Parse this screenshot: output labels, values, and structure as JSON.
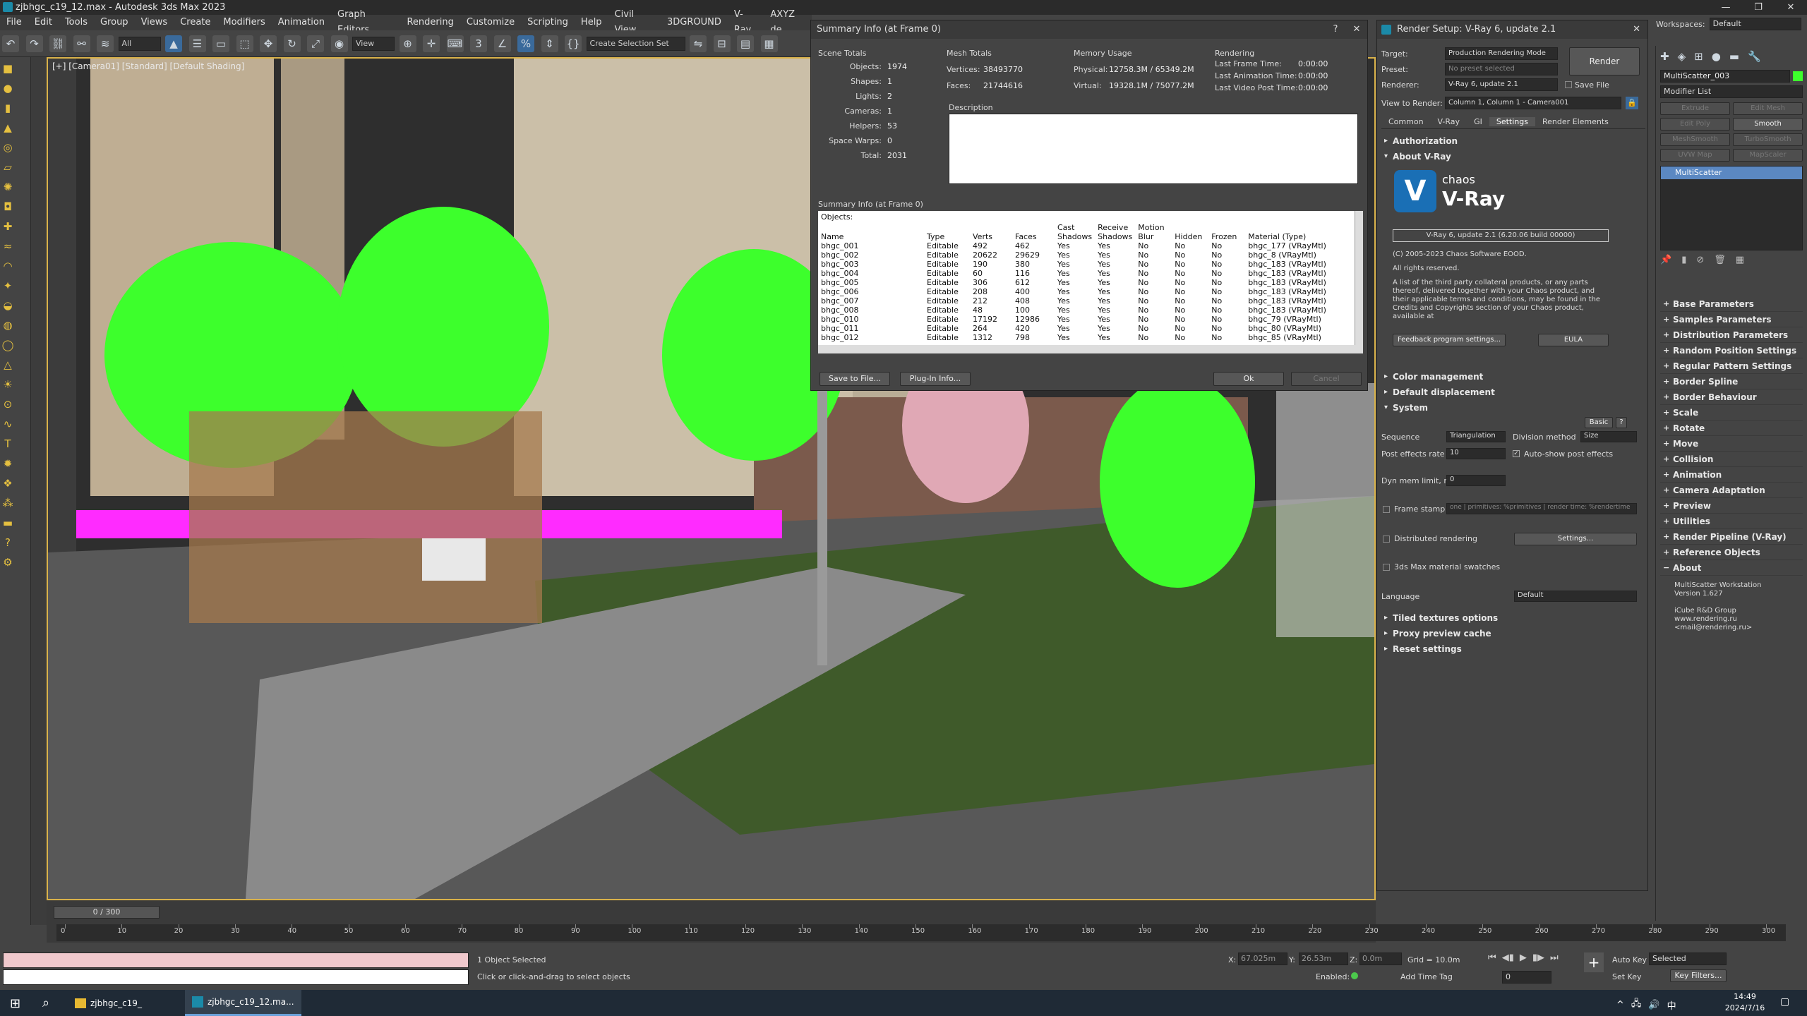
{
  "app": {
    "title": "zjbhgc_c19_12.max - Autodesk 3ds Max 2023",
    "workspaces_label": "Workspaces:",
    "workspaces_value": "Default"
  },
  "menu": [
    "File",
    "Edit",
    "Tools",
    "Group",
    "Views",
    "Create",
    "Modifiers",
    "Animation",
    "Graph Editors",
    "Rendering",
    "Customize",
    "Scripting",
    "Help",
    "Civil View",
    "3DGROUND",
    "V-Ray",
    "AXYZ de"
  ],
  "toolbar": {
    "filter_all": "All",
    "ref_coord": "View",
    "selection_set": "Create Selection Set"
  },
  "viewport": {
    "label": "[+] [Camera01] [Standard] [Default Shading]"
  },
  "summary": {
    "title": "Summary Info (at Frame 0)",
    "scene_totals_label": "Scene Totals",
    "scene_totals": [
      {
        "k": "Objects:",
        "v": "1974"
      },
      {
        "k": "Shapes:",
        "v": "1"
      },
      {
        "k": "Lights:",
        "v": "2"
      },
      {
        "k": "Cameras:",
        "v": "1"
      },
      {
        "k": "Helpers:",
        "v": "53"
      },
      {
        "k": "Space Warps:",
        "v": "0"
      },
      {
        "k": "Total:",
        "v": "2031"
      }
    ],
    "mesh_totals_label": "Mesh Totals",
    "vertices_label": "Vertices:",
    "vertices": "38493770",
    "faces_label": "Faces:",
    "faces": "21744616",
    "memory_label": "Memory Usage",
    "physical_label": "Physical:",
    "physical": "12758.3M / 65349.2M",
    "virtual_label": "Virtual:",
    "virtual": "19328.1M / 75077.2M",
    "rendering_label": "Rendering",
    "last_frame_label": "Last Frame Time:",
    "last_frame": "0:00:00",
    "last_anim_label": "Last Animation Time:",
    "last_anim": "0:00:00",
    "last_video_label": "Last Video Post Time:",
    "last_video": "0:00:00",
    "description_label": "Description",
    "list_title": "Summary Info (at Frame 0)",
    "objects_label": "Objects:",
    "columns": [
      "Name",
      "Type",
      "Verts",
      "Faces",
      "Cast Shadows",
      "Receive Shadows",
      "Motion Blur",
      "Hidden",
      "Frozen",
      "Material (Type)"
    ],
    "rows": [
      [
        "bhgc_001",
        "Editable",
        "492",
        "462",
        "Yes",
        "Yes",
        "No",
        "No",
        "No",
        "bhgc_177 (VRayMtl)"
      ],
      [
        "bhgc_002",
        "Editable",
        "20622",
        "29629",
        "Yes",
        "Yes",
        "No",
        "No",
        "No",
        "bhgc_8 (VRayMtl)"
      ],
      [
        "bhgc_003",
        "Editable",
        "190",
        "380",
        "Yes",
        "Yes",
        "No",
        "No",
        "No",
        "bhgc_183 (VRayMtl)"
      ],
      [
        "bhgc_004",
        "Editable",
        "60",
        "116",
        "Yes",
        "Yes",
        "No",
        "No",
        "No",
        "bhgc_183 (VRayMtl)"
      ],
      [
        "bhgc_005",
        "Editable",
        "306",
        "612",
        "Yes",
        "Yes",
        "No",
        "No",
        "No",
        "bhgc_183 (VRayMtl)"
      ],
      [
        "bhgc_006",
        "Editable",
        "208",
        "400",
        "Yes",
        "Yes",
        "No",
        "No",
        "No",
        "bhgc_183 (VRayMtl)"
      ],
      [
        "bhgc_007",
        "Editable",
        "212",
        "408",
        "Yes",
        "Yes",
        "No",
        "No",
        "No",
        "bhgc_183 (VRayMtl)"
      ],
      [
        "bhgc_008",
        "Editable",
        "48",
        "100",
        "Yes",
        "Yes",
        "No",
        "No",
        "No",
        "bhgc_183 (VRayMtl)"
      ],
      [
        "bhgc_010",
        "Editable",
        "17192",
        "12986",
        "Yes",
        "Yes",
        "No",
        "No",
        "No",
        "bhgc_79 (VRayMtl)"
      ],
      [
        "bhgc_011",
        "Editable",
        "264",
        "420",
        "Yes",
        "Yes",
        "No",
        "No",
        "No",
        "bhgc_80 (VRayMtl)"
      ],
      [
        "bhgc_012",
        "Editable",
        "1312",
        "798",
        "Yes",
        "Yes",
        "No",
        "No",
        "No",
        "bhgc_85 (VRayMtl)"
      ]
    ],
    "save_btn": "Save to File...",
    "plugin_btn": "Plug-In Info...",
    "ok_btn": "Ok",
    "cancel_btn": "Cancel"
  },
  "render": {
    "title": "Render Setup: V-Ray 6, update 2.1",
    "target_label": "Target:",
    "target_value": "Production Rendering Mode",
    "preset_label": "Preset:",
    "preset_value": "No preset selected",
    "renderer_label": "Renderer:",
    "renderer_value": "V-Ray 6, update 2.1",
    "save_file_label": "Save File",
    "render_btn": "Render",
    "view_label": "View to Render:",
    "view_value": "Column 1, Column 1 - Camera001",
    "tabs": [
      "Common",
      "V-Ray",
      "GI",
      "Settings",
      "Render Elements"
    ],
    "authorization": "Authorization",
    "about_vray": "About V-Ray",
    "chaos": "chaos",
    "vray": "V-Ray",
    "version": "V-Ray 6, update 2.1 (6.20.06 build 00000)",
    "copyright": "(C) 2005-2023 Chaos Software EOOD.",
    "rights": "All rights reserved.",
    "third_party": "A list of the third party collateral products, or any parts thereof, delivered together with your Chaos product, and their applicable terms and conditions, may be found in the Credits and Copyrights section of your Chaos product, available at",
    "feedback_btn": "Feedback program settings...",
    "eula_btn": "EULA",
    "color_mgmt": "Color management",
    "default_disp": "Default displacement",
    "system": "System",
    "basic_btn": "Basic",
    "help_btn": "?",
    "sequence_label": "Sequence",
    "sequence_value": "Triangulation",
    "division_label": "Division method",
    "division_value": "Size",
    "post_rate_label": "Post effects rate",
    "post_rate_value": "10",
    "auto_show_label": "Auto-show post effects",
    "dyn_mem_label": "Dyn mem limit, mb",
    "dyn_mem_value": "0",
    "frame_stamp_label": "Frame stamp",
    "frame_stamp_value": "one | primitives: %primitives | render time: %rendertime",
    "distributed_label": "Distributed rendering",
    "settings_btn": "Settings...",
    "swatches_label": "3ds Max material swatches",
    "language_label": "Language",
    "language_value": "Default",
    "tiled": "Tiled textures options",
    "proxy": "Proxy preview cache",
    "reset": "Reset settings"
  },
  "cmd": {
    "object_name": "MultiScatter_003",
    "modifier_list": "Modifier List",
    "mod_buttons": [
      "Extrude",
      "Edit Mesh",
      "Edit Poly",
      "Smooth",
      "MeshSmooth",
      "TurboSmooth",
      "UVW Map",
      "MapScaler"
    ],
    "stack_item": "MultiScatter",
    "rollouts": [
      "Base Parameters",
      "Samples Parameters",
      "Distribution Parameters",
      "Random Position Settings",
      "Regular Pattern Settings",
      "Border Spline",
      "Border Behaviour",
      "Scale",
      "Rotate",
      "Move",
      "Collision",
      "Animation",
      "Camera Adaptation",
      "Preview",
      "Utilities",
      "Render Pipeline (V-Ray)",
      "Reference Objects",
      "About"
    ],
    "about_lines": [
      "MultiScatter Workstation",
      "Version 1.627",
      "",
      "iCube R&D Group",
      "www.rendering.ru",
      "<mail@rendering.ru>"
    ]
  },
  "timeline": {
    "frame_counter": "0 / 300",
    "ticks": [
      "0",
      "10",
      "20",
      "30",
      "40",
      "50",
      "60",
      "70",
      "80",
      "90",
      "100",
      "110",
      "120",
      "130",
      "140",
      "150",
      "160",
      "170",
      "180",
      "190",
      "200",
      "210",
      "220",
      "230",
      "240",
      "250",
      "260",
      "270",
      "280",
      "290",
      "300"
    ]
  },
  "status": {
    "selection": "1 Object Selected",
    "prompt": "Click or click-and-drag to select objects",
    "x_label": "X:",
    "x_value": "67.025m",
    "y_label": "Y:",
    "y_value": "26.53m",
    "z_label": "Z:",
    "z_value": "0.0m",
    "grid": "Grid = 10.0m",
    "enabled": "Enabled:",
    "add_time_tag": "Add Time Tag",
    "auto_key": "Auto Key",
    "set_key": "Set Key",
    "selected": "Selected",
    "key_filters": "Key Filters...",
    "frame_field": "0"
  },
  "taskbar": {
    "item1": "zjbhgc_c19_",
    "item2": "zjbhgc_c19_12.ma...",
    "time": "14:49",
    "date": "2024/7/16"
  },
  "colors": {
    "accent_blue": "#5b88c2",
    "viewport_border": "#d9b24a",
    "vray_logo": "#1a6fb5",
    "foliage_green": "#3dff2c",
    "magenta": "#ff2bff"
  }
}
